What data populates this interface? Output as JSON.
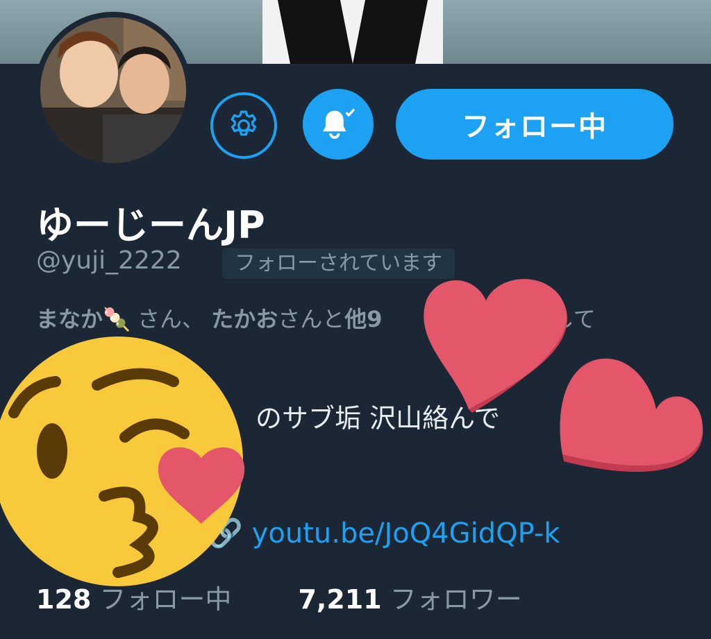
{
  "profile": {
    "display_name": "ゆーじーんJP",
    "handle": "@yuji_2222",
    "follows_you_badge": "フォローされています",
    "follower_context": {
      "name1": "まなか",
      "sep1": "さん、",
      "name2": "たかお",
      "mid": "さんと",
      "others": "他9",
      "tail": "ローして"
    },
    "bio": "のサブ垢 沢山絡んで",
    "link": "youtu.be/JoQ4GidQP-k"
  },
  "actions": {
    "follow_label": "フォロー中",
    "settings_icon": "gear-icon",
    "notify_icon": "bell-check-icon"
  },
  "stats": {
    "following_count": "128",
    "following_label": "フォロー中",
    "followers_count": "7,211",
    "followers_label": "フォロワー"
  },
  "colors": {
    "accent": "#1da1f2",
    "background": "#1b2734",
    "muted_text": "#8899a6",
    "heart": "#e4576b",
    "emoji_face": "#f8c93a"
  }
}
